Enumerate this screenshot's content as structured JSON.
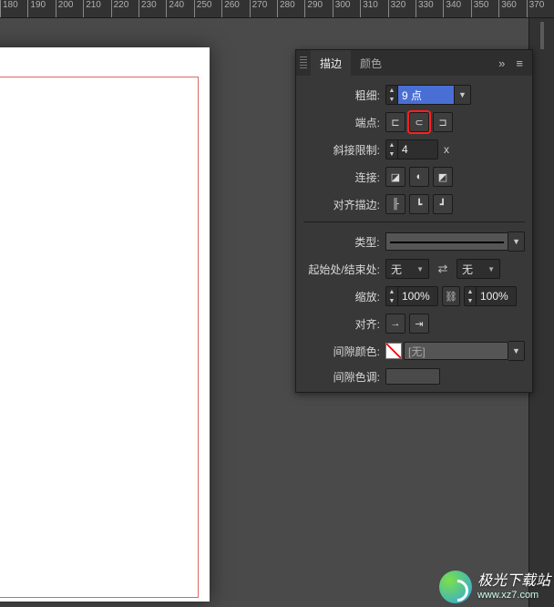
{
  "ruler": {
    "start": 180,
    "end": 370,
    "step": 10
  },
  "panel": {
    "tabs": {
      "stroke": "描边",
      "color": "颜色"
    },
    "menu_icons": {
      "expand": "»",
      "options": "≡"
    },
    "rows": {
      "weight": {
        "label": "粗细:",
        "value": "9 点"
      },
      "cap": {
        "label": "端点:"
      },
      "miter": {
        "label": "斜接限制:",
        "value": "4",
        "suffix": "x"
      },
      "join": {
        "label": "连接:"
      },
      "alignStroke": {
        "label": "对齐描边:"
      },
      "type": {
        "label": "类型:"
      },
      "startEnd": {
        "label": "起始处/结束处:",
        "startValue": "无",
        "endValue": "无"
      },
      "scale": {
        "label": "缩放:",
        "value1": "100%",
        "value2": "100%"
      },
      "align": {
        "label": "对齐:"
      },
      "gapColor": {
        "label": "间隙颜色:",
        "value": "[无]"
      },
      "gapTint": {
        "label": "间隙色调:"
      }
    }
  },
  "watermark": {
    "title": "极光下载站",
    "url": "www.xz7.com"
  }
}
